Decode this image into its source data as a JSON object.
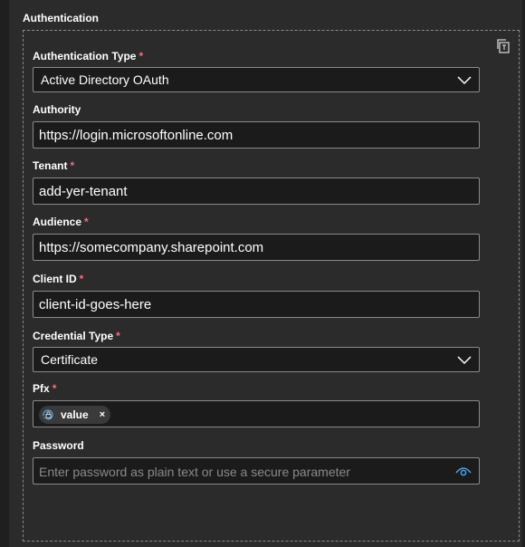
{
  "section": {
    "title": "Authentication"
  },
  "fields": {
    "auth_type": {
      "label": "Authentication Type",
      "required_mark": "*",
      "value": "Active Directory OAuth"
    },
    "authority": {
      "label": "Authority",
      "value": "https://login.microsoftonline.com"
    },
    "tenant": {
      "label": "Tenant",
      "required_mark": "*",
      "value": "add-yer-tenant"
    },
    "audience": {
      "label": "Audience",
      "required_mark": "*",
      "value": "https://somecompany.sharepoint.com"
    },
    "client_id": {
      "label": "Client ID",
      "required_mark": "*",
      "value": "client-id-goes-here"
    },
    "credential_type": {
      "label": "Credential Type",
      "required_mark": "*",
      "value": "Certificate"
    },
    "pfx": {
      "label": "Pfx",
      "required_mark": "*",
      "token": "value",
      "token_remove": "×"
    },
    "password": {
      "label": "Password",
      "placeholder": "Enter password as plain text or use a secure parameter"
    }
  },
  "icons": {
    "copy": "copy-icon",
    "chevron": "chevron-down-icon",
    "parameter": "parameter-lock-icon",
    "eye": "eye-icon"
  },
  "colors": {
    "required": "#f1707b",
    "accent": "#4aa3e8"
  }
}
